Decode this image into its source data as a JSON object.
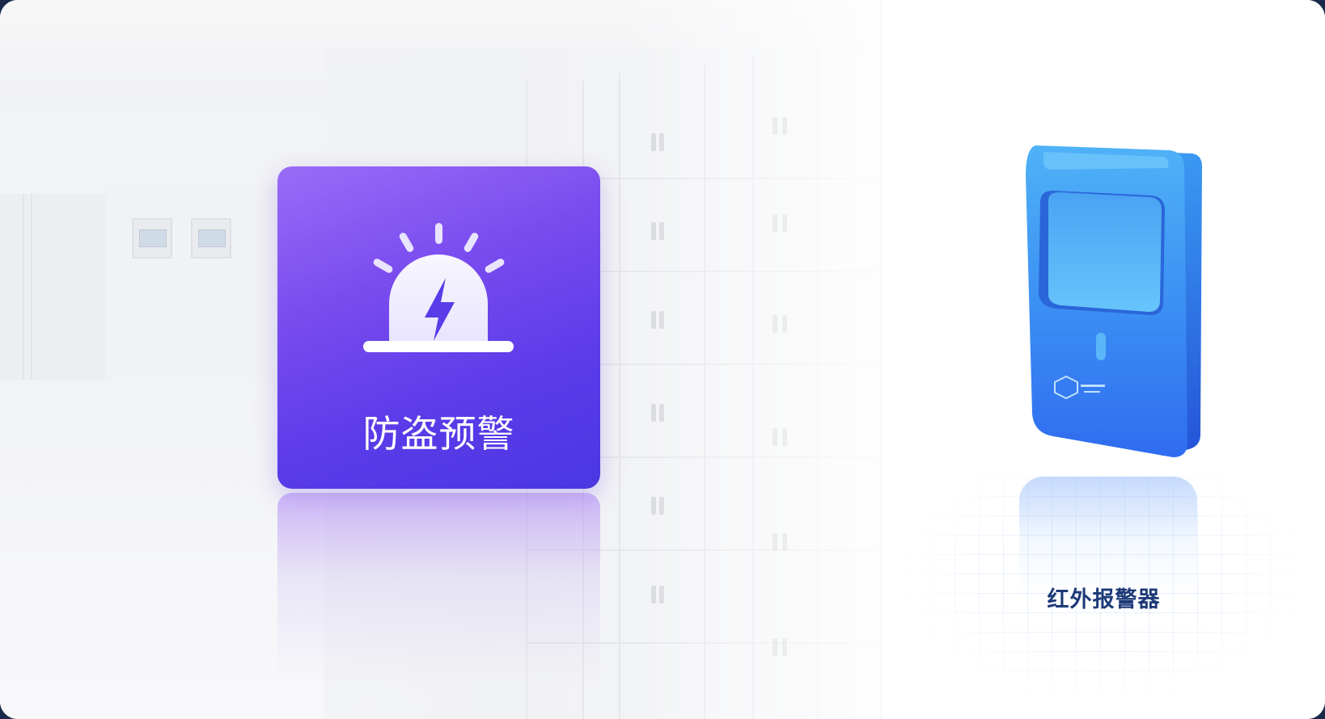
{
  "alert_card": {
    "label": "防盗预警",
    "icon": "siren-alarm-icon",
    "gradient_start": "#9b6cf7",
    "gradient_end": "#4b37e2"
  },
  "device": {
    "label": "红外报警器",
    "icon": "infrared-sensor-device",
    "color": "#3f8ef5",
    "label_color": "#1d3a78"
  }
}
